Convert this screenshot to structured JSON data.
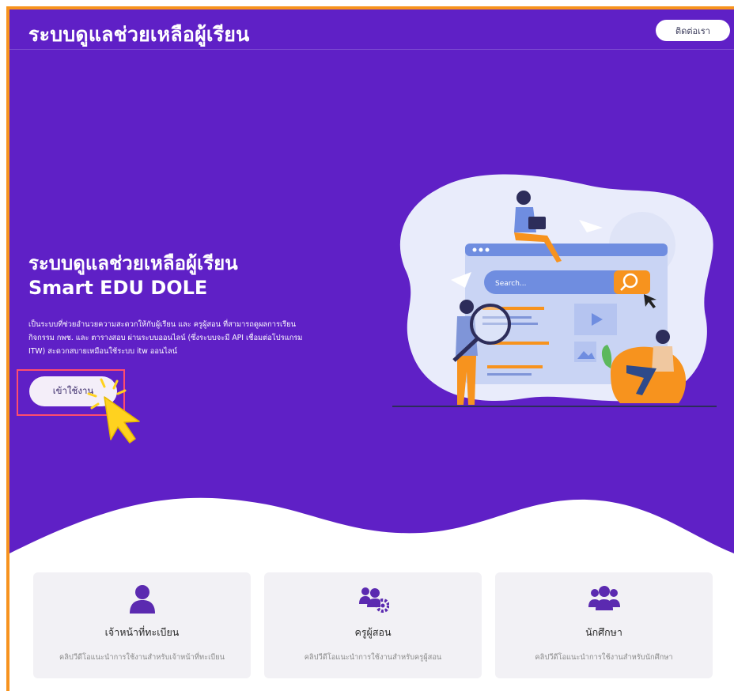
{
  "header": {
    "brand": "ระบบดูแลช่วยเหลือผู้เรียน",
    "contact_label": "ติดต่อเรา"
  },
  "hero": {
    "title_line1": "ระบบดูแลช่วยเหลือผู้เรียน",
    "title_line2": "Smart EDU DOLE",
    "desc_line1": "เป็นระบบที่ช่วยอำนวยความสะดวกให้กับผู้เรียน และ ครูผู้สอน ที่สามารถดูผลการเรียน",
    "desc_line2": "กิจกรรม กพช. และ ตารางสอบ ผ่านระบบออนไลน์ (ซึ่งระบบจะมี API เชื่อมต่อโปรแกรม",
    "desc_line3": "ITW) สะดวกสบายเหมือนใช้ระบบ itw ออนไลน์",
    "start_label": "เข้าใช้งาน"
  },
  "illustration": {
    "search_placeholder": "Search...",
    "icons": [
      "search-icon",
      "play-icon",
      "image-icon",
      "laptop-icon",
      "paper-plane-icon"
    ]
  },
  "cards": [
    {
      "icon": "user-icon",
      "title": "เจ้าหน้าที่ทะเบียน",
      "subtitle": "คลิปวีดีโอแนะนำการใช้งานสำหรับเจ้าหน้าที่ทะเบียน"
    },
    {
      "icon": "teacher-gear-icon",
      "title": "ครูผู้สอน",
      "subtitle": "คลิปวีดีโอแนะนำการใช้งานสำหรับครูผู้สอน"
    },
    {
      "icon": "users-group-icon",
      "title": "นักศึกษา",
      "subtitle": "คลิปวีดีโอแนะนำการใช้งานสำหรับนักศึกษา"
    }
  ],
  "colors": {
    "hero_bg": "#5f20c6",
    "accent": "#f7931e",
    "highlight": "#ff4d6d",
    "card_icon": "#5b2ab0"
  }
}
